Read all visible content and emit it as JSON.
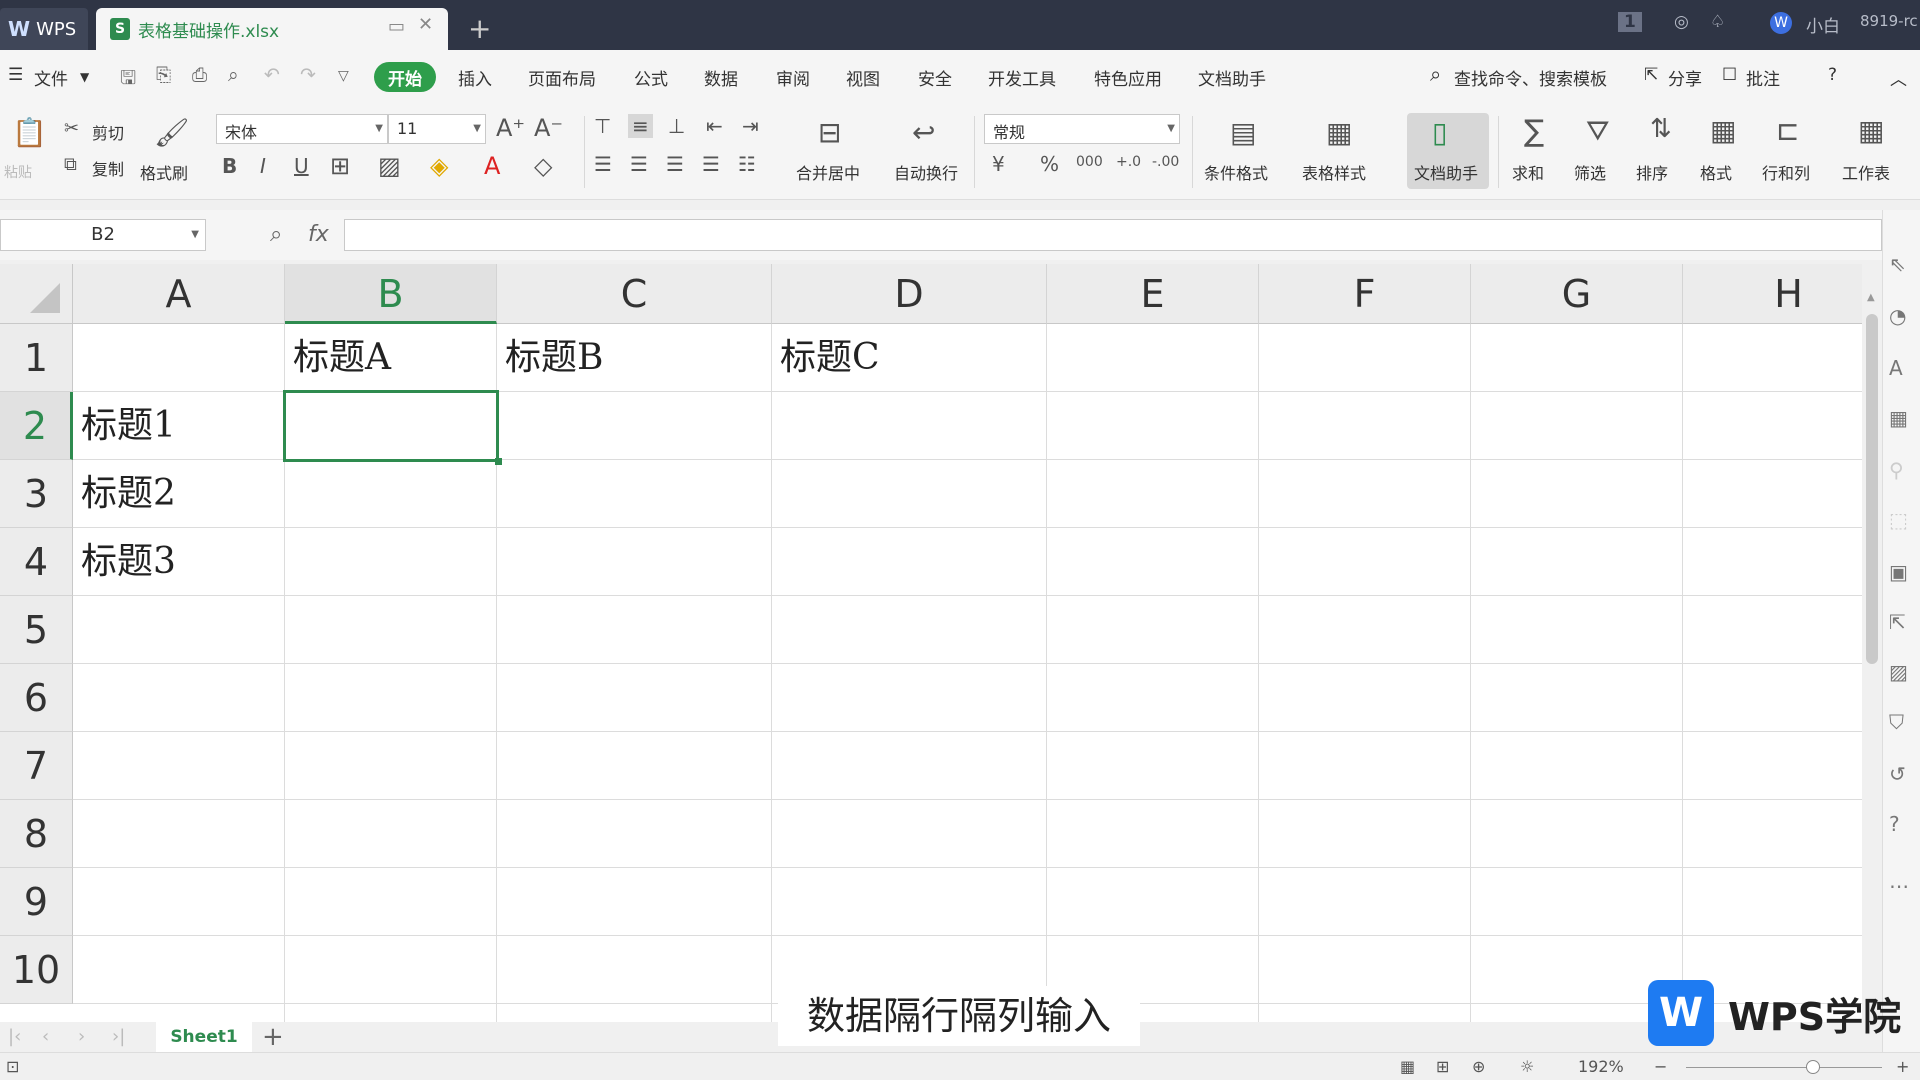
{
  "titlebar": {
    "app_tab": "WPS",
    "document_tab": "表格基础操作.xlsx",
    "new_tab": "+",
    "badge_number": "1",
    "user_name": "小白",
    "account_id": "8919-rc"
  },
  "menu": {
    "file": "文件",
    "items": [
      "开始",
      "插入",
      "页面布局",
      "公式",
      "数据",
      "审阅",
      "视图",
      "安全",
      "开发工具",
      "特色应用",
      "文档助手"
    ],
    "search_placeholder": "查找命令、搜索模板",
    "share": "分享",
    "comment": "批注",
    "help": "?"
  },
  "ribbon": {
    "paste": "粘贴",
    "cut": "剪切",
    "copy": "复制",
    "format_painter": "格式刷",
    "font_name": "宋体",
    "font_size": "11",
    "number_format": "常规",
    "merge_center": "合并居中",
    "wrap_text": "自动换行",
    "conditional_format": "条件格式",
    "table_style": "表格样式",
    "doc_helper": "文档助手",
    "sum": "求和",
    "filter": "筛选",
    "sort": "排序",
    "format": "格式",
    "row_col": "行和列",
    "worksheet": "工作表"
  },
  "formula_bar": {
    "cell_ref": "B2",
    "fx": "fx",
    "content": ""
  },
  "grid": {
    "columns": [
      "A",
      "B",
      "C",
      "D",
      "E",
      "F",
      "G",
      "H"
    ],
    "rows": [
      "1",
      "2",
      "3",
      "4",
      "5",
      "6",
      "7",
      "8",
      "9",
      "10"
    ],
    "active_column": "B",
    "active_row": "2",
    "cells": {
      "B1": "标题A",
      "C1": "标题B",
      "D1": "标题C",
      "A2": "标题1",
      "A3": "标题2",
      "A4": "标题3"
    }
  },
  "sheets": {
    "tabs": [
      "Sheet1"
    ],
    "add": "+"
  },
  "status": {
    "zoom": "192%"
  },
  "overlay": {
    "caption": "数据隔行隔列输入",
    "watermark_text": "WPS学院",
    "watermark_logo": "W"
  },
  "colors": {
    "accent": "#2e8b4f",
    "titlebar": "#2f3545",
    "watermark_blue": "#1e7bf2"
  }
}
